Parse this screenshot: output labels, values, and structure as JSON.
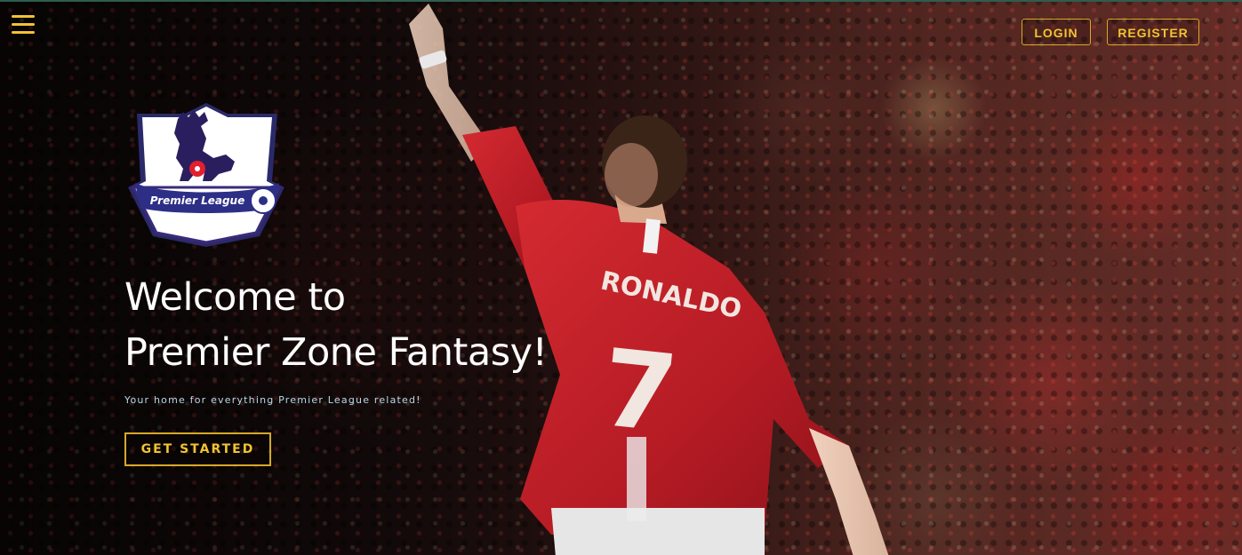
{
  "nav": {
    "menu_icon": "hamburger-menu-icon",
    "login_label": "LOGIN",
    "register_label": "REGISTER"
  },
  "logo": {
    "text": "Premier League"
  },
  "hero": {
    "title_line1": "Welcome to",
    "title_line2": "Premier Zone Fantasy!",
    "subtitle": "Your home for everything Premier League related!",
    "cta_label": "GET STARTED"
  },
  "player": {
    "shirt_name": "RONALDO",
    "shirt_number": "7"
  },
  "colors": {
    "accent": "#f2c232",
    "subtitle": "#b7d8e8",
    "shirt_red": "#c8202a"
  }
}
